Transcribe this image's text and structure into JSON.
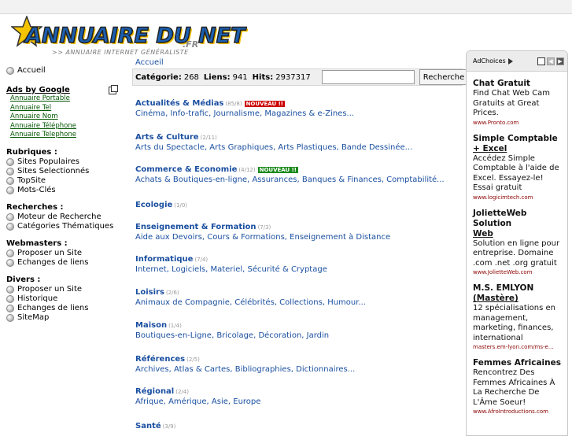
{
  "logo": {
    "title": "ANNUAIRE DU NET",
    "tld": ".FR",
    "tagline": ">> ANNUAIRE INTERNET GÉNÉRALISTE"
  },
  "sidebar": {
    "home": "Accueil",
    "ads_title": "Ads by Google",
    "ad_links": [
      "Annuaire Portable",
      "Annuaire Tel",
      "Annuaire Nom",
      "Annuaire Téléphone",
      "Annuaire Telephone"
    ],
    "rubriques_title": "Rubriques :",
    "rubriques": [
      "Sites Populaires",
      "Sites Selectionnés",
      "TopSite",
      "Mots-Clés"
    ],
    "recherches_title": "Recherches :",
    "recherches": [
      "Moteur de Recherche",
      "Catégories Thématiques"
    ],
    "webmasters_title": "Webmasters :",
    "webmasters": [
      "Proposer un Site",
      "Echanges de liens"
    ],
    "divers_title": "Divers :",
    "divers": [
      "Proposer un Site",
      "Historique",
      "Echanges de liens",
      "SiteMap"
    ]
  },
  "main": {
    "breadcrumb": "Accueil",
    "stats": {
      "categorie_label": "Catégorie:",
      "categorie_value": "268",
      "liens_label": "Liens:",
      "liens_value": "941",
      "hits_label": "Hits:",
      "hits_value": "2937317"
    },
    "search": {
      "value": "",
      "button": "Recherche"
    },
    "categories": [
      {
        "title": "Actualités & Médias",
        "count": "(85/8)",
        "badge": "NOUVEAU !!",
        "badge_color": "#cc0000",
        "sub": "Cinéma, Info-trafic, Journalisme, Magazines & e-Zines..."
      },
      {
        "title": "Arts & Culture",
        "count": "(2/11)",
        "badge": "",
        "sub": "Arts du Spectacle, Arts Graphiques, Arts Plastiques, Bande Dessinée..."
      },
      {
        "title": "Commerce & Economie",
        "count": "(4/12)",
        "badge": "NOUVEAU !!",
        "badge_color": "#1a8a1a",
        "sub": "Achats & Boutiques-en-ligne, Assurances, Banques & Finances, Comptabilité..."
      },
      {
        "title": "Ecologie",
        "count": "(1/0)",
        "badge": "",
        "sub": ""
      },
      {
        "title": "Enseignement & Formation",
        "count": "(7/3)",
        "badge": "",
        "sub": "Aide aux Devoirs, Cours & Formations, Enseignement à Distance"
      },
      {
        "title": "Informatique",
        "count": "(7/4)",
        "badge": "",
        "sub": "Internet, Logiciels, Materiel, Sécurité & Cryptage"
      },
      {
        "title": "Loisirs",
        "count": "(2/6)",
        "badge": "",
        "sub": "Animaux de Compagnie, Célébrités, Collections, Humour..."
      },
      {
        "title": "Maison",
        "count": "(1/4)",
        "badge": "",
        "sub": "Boutiques-en-Ligne, Bricolage, Décoration, Jardin"
      },
      {
        "title": "Références",
        "count": "(2/5)",
        "badge": "",
        "sub": "Archives, Atlas & Cartes, Bibliographies, Dictionnaires..."
      },
      {
        "title": "Régional",
        "count": "(2/4)",
        "badge": "",
        "sub": "Afrique, Amérique, Asie, Europe"
      },
      {
        "title": "Santé",
        "count": "(3/9)",
        "badge": "",
        "sub": ""
      }
    ]
  },
  "adpanel": {
    "adchoices": "AdChoices",
    "ads": [
      {
        "title": "Chat Gratuit",
        "title2": "",
        "body": "Find Chat Web Cam Gratuits at Great Prices.",
        "url": "www.Pronto.com"
      },
      {
        "title": "Simple Comptable",
        "title2": "+ Excel",
        "body": "Accédez Simple Comptable à l'aide de Excel. Essayez-le! Essai gratuit",
        "url": "www.logicimtech.com"
      },
      {
        "title": "JolietteWeb Solution",
        "title2": "Web",
        "body": "Solution en ligne pour entreprise. Domaine .com .net .org gratuit",
        "url": "www.JolietteWeb.com"
      },
      {
        "title": "M.S. EMLYON",
        "title2": "(Mastère)",
        "body": "12 spécialisations en management, marketing, finances, international",
        "url": "masters.em-lyon.com/ms-e..."
      },
      {
        "title": "Femmes Africaines",
        "title2": "",
        "body": "Rencontrez Des Femmes Africaines À La Recherche De L'Âme Soeur!",
        "url": "www.AfroIntroductions.com"
      }
    ]
  }
}
